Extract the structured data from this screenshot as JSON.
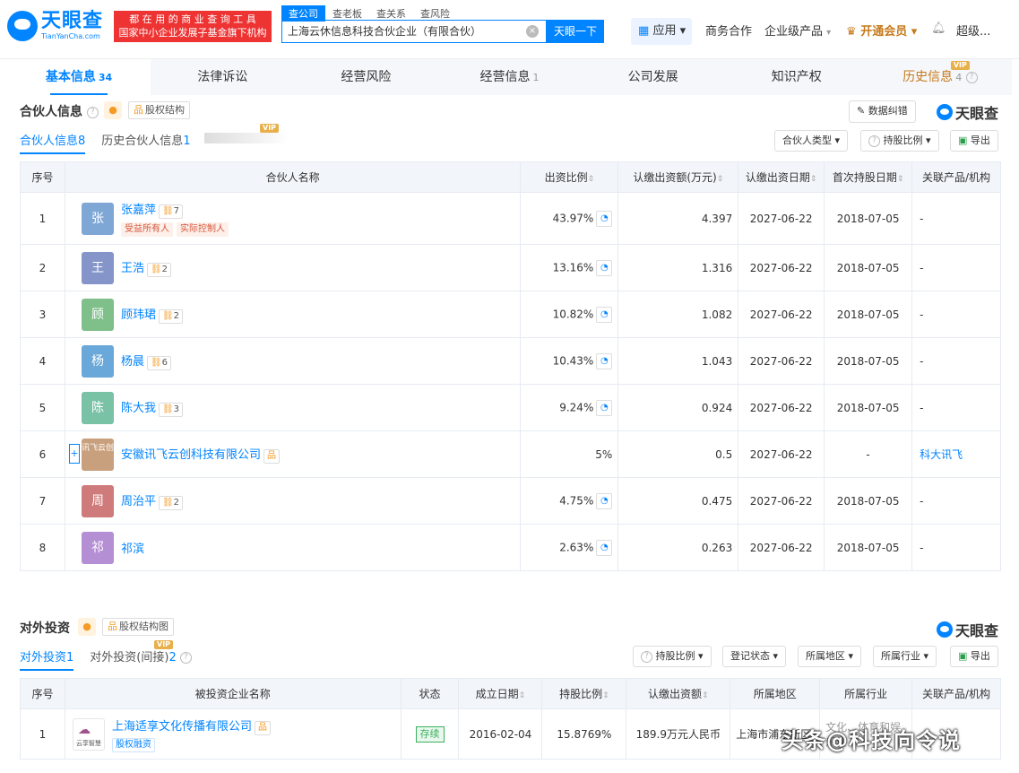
{
  "header": {
    "logo_cn": "天眼查",
    "logo_en": "TianYanCha.com",
    "slogan_line1": "都 在 用 的 商 业 查 询 工 具",
    "slogan_line2": "国家中小企业发展子基金旗下机构",
    "search_tabs": [
      "查公司",
      "查老板",
      "查关系",
      "查风险"
    ],
    "search_value": "上海云休信息科技合伙企业（有限合伙）",
    "search_button": "天眼一下",
    "app_label": "应用",
    "biz_label": "商务合作",
    "enterprise_label": "企业级产品",
    "member_label": "开通会员",
    "user_label": "超级..."
  },
  "tabs": [
    {
      "label": "基本信息",
      "count": "34"
    },
    {
      "label": "法律诉讼",
      "count": ""
    },
    {
      "label": "经营风险",
      "count": ""
    },
    {
      "label": "经营信息",
      "count": "1"
    },
    {
      "label": "公司发展",
      "count": ""
    },
    {
      "label": "知识产权",
      "count": ""
    },
    {
      "label": "历史信息",
      "count": "4"
    }
  ],
  "partners": {
    "title": "合伙人信息",
    "equity_label": "股权结构",
    "correction_label": "数据纠错",
    "brand": "天眼查",
    "subtab_current": "合伙人信息",
    "subtab_current_count": "8",
    "subtab_history": "历史合伙人信息",
    "subtab_history_count": "1",
    "filters": [
      "合伙人类型",
      "持股比例"
    ],
    "export_label": "导出",
    "columns": [
      "序号",
      "合伙人名称",
      "出资比例",
      "认缴出资额(万元)",
      "认缴出资日期",
      "首次持股日期",
      "关联产品/机构"
    ],
    "rows": [
      {
        "no": "1",
        "avatar": "张",
        "color": "#7fa7d6",
        "name": "张嘉萍",
        "rel": "7",
        "tags": [
          "受益所有人",
          "实际控制人"
        ],
        "ratio": "43.97%",
        "amount": "4.397",
        "date": "2027-06-22",
        "first": "2018-07-05",
        "related": "-"
      },
      {
        "no": "2",
        "avatar": "王",
        "color": "#8595c9",
        "name": "王浩",
        "rel": "2",
        "tags": [],
        "ratio": "13.16%",
        "amount": "1.316",
        "date": "2027-06-22",
        "first": "2018-07-05",
        "related": "-"
      },
      {
        "no": "3",
        "avatar": "顾",
        "color": "#7fbf8a",
        "name": "顾玮珺",
        "rel": "2",
        "tags": [],
        "ratio": "10.82%",
        "amount": "1.082",
        "date": "2027-06-22",
        "first": "2018-07-05",
        "related": "-"
      },
      {
        "no": "4",
        "avatar": "杨",
        "color": "#6aa8d9",
        "name": "杨晨",
        "rel": "6",
        "tags": [],
        "ratio": "10.43%",
        "amount": "1.043",
        "date": "2027-06-22",
        "first": "2018-07-05",
        "related": "-"
      },
      {
        "no": "5",
        "avatar": "陈",
        "color": "#79c2a6",
        "name": "陈大我",
        "rel": "3",
        "tags": [],
        "ratio": "9.24%",
        "amount": "0.924",
        "date": "2027-06-22",
        "first": "2018-07-05",
        "related": "-"
      },
      {
        "no": "6",
        "avatar": "讯飞云创",
        "color": "#c9a07d",
        "name": "安徽讯飞云创科技有限公司",
        "rel": "",
        "tags": [],
        "ratio": "5%",
        "amount": "0.5",
        "date": "2027-06-22",
        "first": "-",
        "related": "科大讯飞"
      },
      {
        "no": "7",
        "avatar": "周",
        "color": "#cf7b7b",
        "name": "周治平",
        "rel": "2",
        "tags": [],
        "ratio": "4.75%",
        "amount": "0.475",
        "date": "2027-06-22",
        "first": "2018-07-05",
        "related": "-"
      },
      {
        "no": "8",
        "avatar": "祁",
        "color": "#b48fd3",
        "name": "祁滨",
        "rel": "",
        "tags": [],
        "ratio": "2.63%",
        "amount": "0.263",
        "date": "2027-06-22",
        "first": "2018-07-05",
        "related": "-"
      }
    ]
  },
  "investment": {
    "title": "对外投资",
    "equity_label": "股权结构图",
    "brand": "天眼查",
    "subtab_direct": "对外投资",
    "subtab_direct_count": "1",
    "subtab_indirect": "对外投资(间接)",
    "subtab_indirect_count": "2",
    "filters": [
      "持股比例",
      "登记状态",
      "所属地区",
      "所属行业"
    ],
    "export_label": "导出",
    "columns": [
      "序号",
      "被投资企业名称",
      "状态",
      "成立日期",
      "持股比例",
      "认缴出资额",
      "所属地区",
      "所属行业",
      "关联产品/机构"
    ],
    "rows": [
      {
        "no": "1",
        "logo": "云享智慧",
        "name": "上海适享文化传播有限公司",
        "tag": "股权融资",
        "status": "存续",
        "date": "2016-02-04",
        "ratio": "15.8769%",
        "amount": "189.9万元人民币",
        "region": "上海市浦东新区",
        "industry": "文化、体育和娱乐业",
        "related": ""
      }
    ]
  },
  "watermark": "头条@科技向令说"
}
